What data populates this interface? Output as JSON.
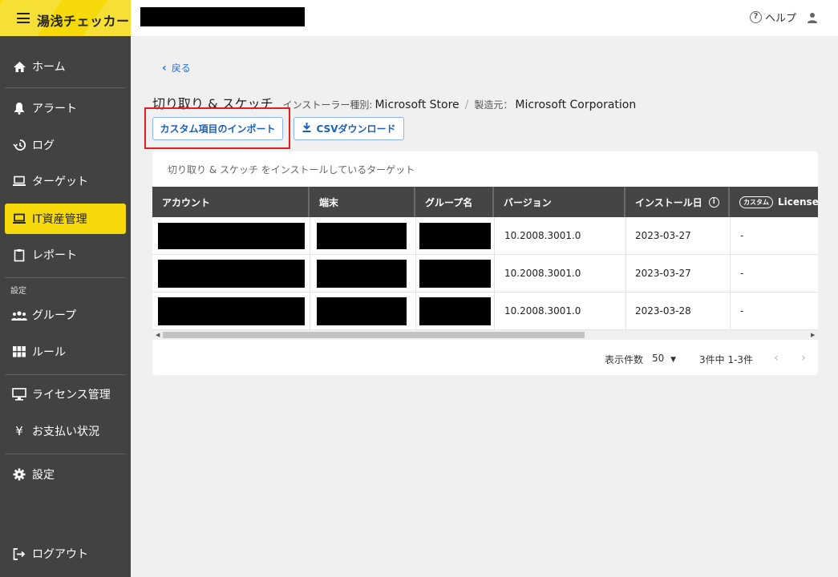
{
  "app": {
    "title": "湯浅チェッカー"
  },
  "sidebar": {
    "items": [
      {
        "label": "ホーム",
        "icon": "home-icon"
      },
      {
        "label": "アラート",
        "icon": "bell-icon"
      },
      {
        "label": "ログ",
        "icon": "history-icon"
      },
      {
        "label": "ターゲット",
        "icon": "laptop-icon"
      },
      {
        "label": "IT資産管理",
        "icon": "laptop-icon",
        "active": true
      },
      {
        "label": "レポート",
        "icon": "clipboard-icon"
      }
    ],
    "section_label": "設定",
    "settings_items": [
      {
        "label": "グループ",
        "icon": "group-icon"
      },
      {
        "label": "ルール",
        "icon": "grid-icon"
      },
      {
        "label": "ライセンス管理",
        "icon": "monitor-icon"
      },
      {
        "label": "お支払い状況",
        "icon": "yen-icon"
      },
      {
        "label": "設定",
        "icon": "gear-icon"
      }
    ],
    "logout_label": "ログアウト"
  },
  "header": {
    "help_label": "ヘルプ"
  },
  "main": {
    "back_label": "戻る",
    "title": "切り取り & スケッチ",
    "installer_label": "インストーラー種別:",
    "installer_value": "Microsoft Store",
    "maker_label": "製造元：",
    "maker_value": "Microsoft Corporation",
    "import_button": "カスタム項目のインポート",
    "csv_button": "CSVダウンロード",
    "table_caption": "切り取り & スケッチ をインストールしているターゲット",
    "columns": [
      "アカウント",
      "端末",
      "グループ名",
      "バージョン",
      "インストール日",
      "License K"
    ],
    "custom_badge": "カスタム",
    "rows": [
      {
        "version": "10.2008.3001.0",
        "install_date": "2023-03-27",
        "license": "-"
      },
      {
        "version": "10.2008.3001.0",
        "install_date": "2023-03-27",
        "license": "-"
      },
      {
        "version": "10.2008.3001.0",
        "install_date": "2023-03-28",
        "license": "-"
      }
    ],
    "pagination": {
      "per_page_label": "表示件数",
      "per_page_value": "50",
      "range_text": "3件中 1-3件"
    }
  },
  "colors": {
    "accent": "#f5d90a",
    "sidebar": "#424242",
    "link": "#1a73e8",
    "highlight": "#e02020"
  }
}
